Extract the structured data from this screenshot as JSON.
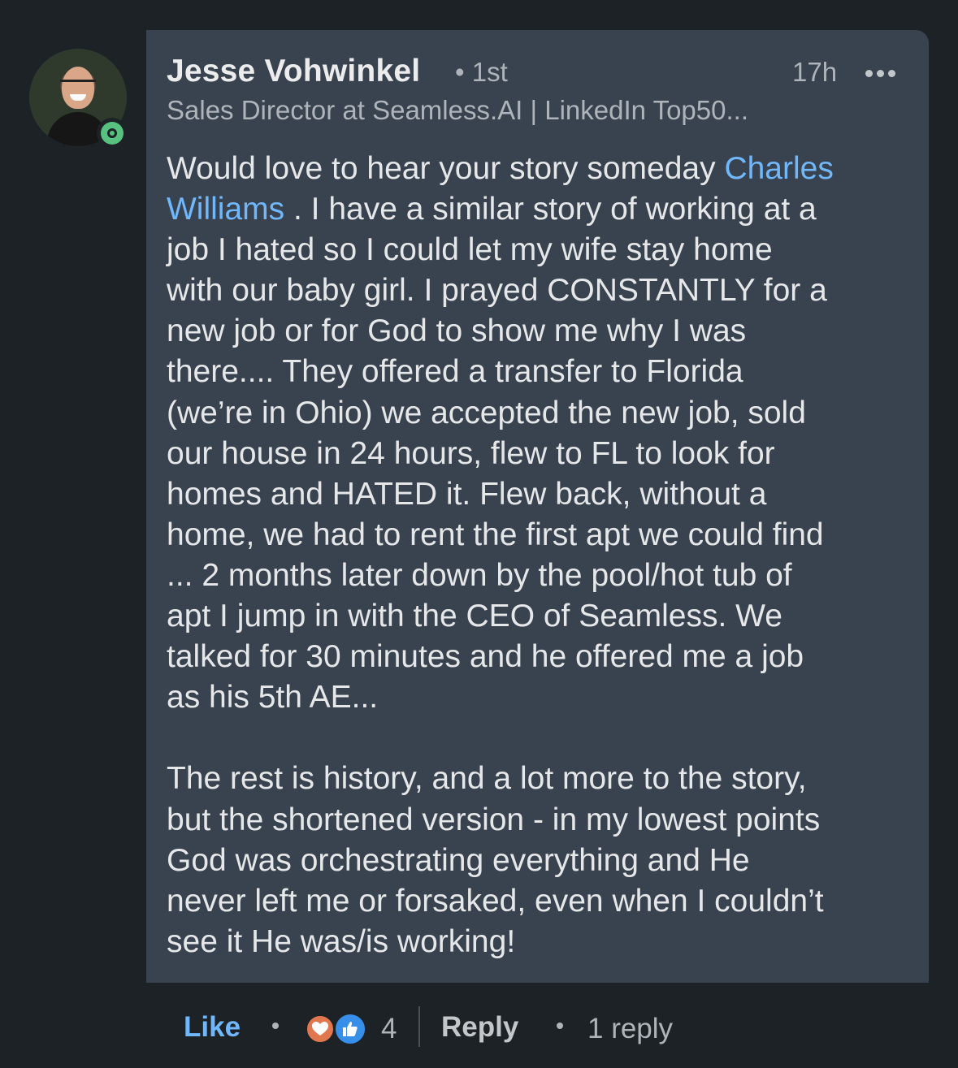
{
  "author": {
    "name": "Jesse Vohwinkel",
    "degree": "• 1st",
    "headline": "Sales Director at Seamless.AI | LinkedIn Top50...",
    "status": "online"
  },
  "comment": {
    "time": "17h",
    "lines": [
      {
        "pre": "Would love to hear your story someday ",
        "mention": "Charles",
        "post": ""
      },
      {
        "pre": "",
        "mention": "Williams",
        "post": " . I have a similar story of working at a"
      },
      {
        "pre": "job I hated so I could let my wife stay home",
        "mention": "",
        "post": ""
      },
      {
        "pre": "with our baby girl. I prayed CONSTANTLY for a",
        "mention": "",
        "post": ""
      },
      {
        "pre": "new job or for God to show me why I was",
        "mention": "",
        "post": ""
      },
      {
        "pre": "there.... They offered a transfer to Florida",
        "mention": "",
        "post": ""
      },
      {
        "pre": "(we’re in Ohio) we accepted the new job, sold",
        "mention": "",
        "post": ""
      },
      {
        "pre": "our house in 24 hours, flew to FL to look for",
        "mention": "",
        "post": ""
      },
      {
        "pre": "homes and HATED it. Flew back, without a",
        "mention": "",
        "post": ""
      },
      {
        "pre": "home, we had to rent the first apt we could find",
        "mention": "",
        "post": ""
      },
      {
        "pre": "... 2 months later down by the pool/hot tub of",
        "mention": "",
        "post": ""
      },
      {
        "pre": "apt I jump in with the CEO of Seamless. We",
        "mention": "",
        "post": ""
      },
      {
        "pre": "talked for 30 minutes and he offered me a job",
        "mention": "",
        "post": ""
      },
      {
        "pre": "as his 5th AE...",
        "mention": "",
        "post": ""
      },
      {
        "pre": "",
        "mention": "",
        "post": ""
      },
      {
        "pre": "The rest is history, and a lot more to the story,",
        "mention": "",
        "post": ""
      },
      {
        "pre": "but the shortened version - in my lowest points",
        "mention": "",
        "post": ""
      },
      {
        "pre": "God was orchestrating everything and He",
        "mention": "",
        "post": ""
      },
      {
        "pre": "never left me or forsaked, even when I couldn’t",
        "mention": "",
        "post": ""
      },
      {
        "pre": "see it He was/is working!",
        "mention": "",
        "post": ""
      }
    ]
  },
  "actions": {
    "like_label": "Like",
    "reaction_icons": [
      "love-icon",
      "like-icon"
    ],
    "reaction_count": "4",
    "reply_label": "Reply",
    "replies_label": "1 reply"
  },
  "colors": {
    "background": "#1d2226",
    "bubble": "#38434f",
    "mention": "#71b7fb",
    "like_accent": "#71b7fb",
    "online": "#57c27f"
  }
}
